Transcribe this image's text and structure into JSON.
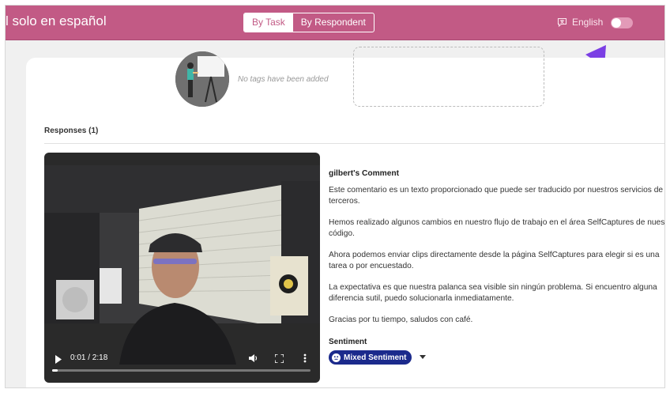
{
  "header": {
    "title": "l solo en español",
    "tabs": [
      {
        "label": "By Task",
        "active": true
      },
      {
        "label": "By Respondent",
        "active": false
      }
    ],
    "language_label": "English",
    "translate_toggle_on": false
  },
  "tags": {
    "empty_text": "No tags have been added"
  },
  "responses": {
    "heading": "Responses (1)",
    "video": {
      "time_label": "0:01 / 2:18",
      "progress": 0.01
    },
    "comment": {
      "author_heading": "gilbert's Comment",
      "paragraphs": [
        "Este comentario es un texto proporcionado que puede ser traducido por nuestros servicios de terceros.",
        "Hemos realizado algunos cambios en nuestro flujo de trabajo en el área SelfCaptures de nuestro código.",
        "Ahora podemos enviar clips directamente desde la página SelfCaptures para elegir si es una tarea o por encuestado.",
        "La expectativa es que nuestra palanca sea visible sin ningún problema. Si encuentro alguna diferencia sutil, puedo solucionarla inmediatamente.",
        "Gracias por tu tiempo, saludos con café."
      ]
    },
    "sentiment": {
      "label": "Sentiment",
      "value": "Mixed Sentiment"
    }
  },
  "colors": {
    "brand": "#c25a85",
    "sentiment_pill": "#1b2a8c",
    "annotation_arrow": "#7b3fe4"
  },
  "icons": [
    "translate-icon",
    "play-icon",
    "volume-icon",
    "fullscreen-icon",
    "more-vertical-icon",
    "neutral-face-icon",
    "chevron-down-icon"
  ]
}
